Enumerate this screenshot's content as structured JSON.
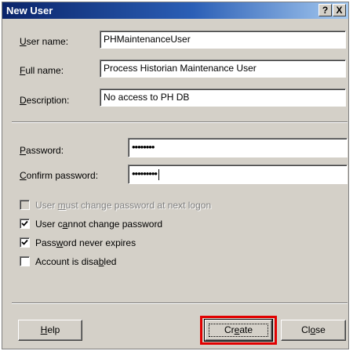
{
  "window": {
    "title": "New User",
    "help_glyph": "?",
    "close_glyph": "X"
  },
  "fields": {
    "username": {
      "label_u": "U",
      "label_rest": "ser name:",
      "value": "PHMaintenanceUser"
    },
    "fullname": {
      "label_u": "F",
      "label_rest": "ull name:",
      "value": "Process Historian Maintenance User"
    },
    "description": {
      "label_u": "D",
      "label_rest": "escription:",
      "value": "No access to PH DB"
    },
    "password": {
      "label_u": "P",
      "label_rest": "assword:",
      "value": "••••••••"
    },
    "confirm": {
      "label_u": "C",
      "label_rest": "onfirm password:",
      "value": "•••••••••"
    }
  },
  "options": {
    "must_change": {
      "pre": "User ",
      "u": "m",
      "post": "ust change password at next logon",
      "checked": false,
      "enabled": false
    },
    "cannot_change": {
      "pre": "User c",
      "u": "a",
      "post": "nnot change password",
      "checked": true,
      "enabled": true
    },
    "never_expires": {
      "pre": "Pass",
      "u": "w",
      "post": "ord never expires",
      "checked": true,
      "enabled": true
    },
    "disabled": {
      "pre": "Account is disa",
      "u": "b",
      "post": "led",
      "checked": false,
      "enabled": true
    }
  },
  "buttons": {
    "help": {
      "u": "H",
      "rest": "elp"
    },
    "create": {
      "pre": "Cr",
      "u": "e",
      "post": "ate"
    },
    "close": {
      "pre": "Cl",
      "u": "o",
      "post": "se"
    }
  },
  "colors": {
    "highlight": "#e10000",
    "titlebar": "#0a246a",
    "face": "#d4d0c8"
  }
}
